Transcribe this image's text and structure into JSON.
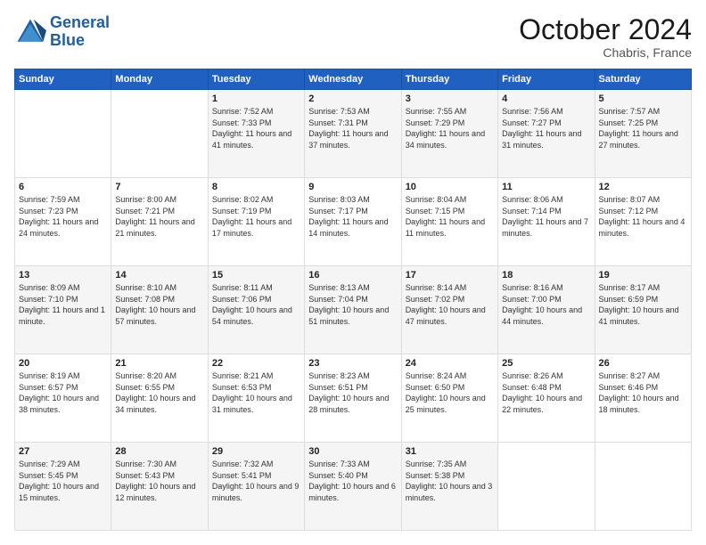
{
  "header": {
    "logo_line1": "General",
    "logo_line2": "Blue",
    "month": "October 2024",
    "location": "Chabris, France"
  },
  "weekdays": [
    "Sunday",
    "Monday",
    "Tuesday",
    "Wednesday",
    "Thursday",
    "Friday",
    "Saturday"
  ],
  "weeks": [
    [
      {
        "day": "",
        "sunrise": "",
        "sunset": "",
        "daylight": ""
      },
      {
        "day": "",
        "sunrise": "",
        "sunset": "",
        "daylight": ""
      },
      {
        "day": "1",
        "sunrise": "Sunrise: 7:52 AM",
        "sunset": "Sunset: 7:33 PM",
        "daylight": "Daylight: 11 hours and 41 minutes."
      },
      {
        "day": "2",
        "sunrise": "Sunrise: 7:53 AM",
        "sunset": "Sunset: 7:31 PM",
        "daylight": "Daylight: 11 hours and 37 minutes."
      },
      {
        "day": "3",
        "sunrise": "Sunrise: 7:55 AM",
        "sunset": "Sunset: 7:29 PM",
        "daylight": "Daylight: 11 hours and 34 minutes."
      },
      {
        "day": "4",
        "sunrise": "Sunrise: 7:56 AM",
        "sunset": "Sunset: 7:27 PM",
        "daylight": "Daylight: 11 hours and 31 minutes."
      },
      {
        "day": "5",
        "sunrise": "Sunrise: 7:57 AM",
        "sunset": "Sunset: 7:25 PM",
        "daylight": "Daylight: 11 hours and 27 minutes."
      }
    ],
    [
      {
        "day": "6",
        "sunrise": "Sunrise: 7:59 AM",
        "sunset": "Sunset: 7:23 PM",
        "daylight": "Daylight: 11 hours and 24 minutes."
      },
      {
        "day": "7",
        "sunrise": "Sunrise: 8:00 AM",
        "sunset": "Sunset: 7:21 PM",
        "daylight": "Daylight: 11 hours and 21 minutes."
      },
      {
        "day": "8",
        "sunrise": "Sunrise: 8:02 AM",
        "sunset": "Sunset: 7:19 PM",
        "daylight": "Daylight: 11 hours and 17 minutes."
      },
      {
        "day": "9",
        "sunrise": "Sunrise: 8:03 AM",
        "sunset": "Sunset: 7:17 PM",
        "daylight": "Daylight: 11 hours and 14 minutes."
      },
      {
        "day": "10",
        "sunrise": "Sunrise: 8:04 AM",
        "sunset": "Sunset: 7:15 PM",
        "daylight": "Daylight: 11 hours and 11 minutes."
      },
      {
        "day": "11",
        "sunrise": "Sunrise: 8:06 AM",
        "sunset": "Sunset: 7:14 PM",
        "daylight": "Daylight: 11 hours and 7 minutes."
      },
      {
        "day": "12",
        "sunrise": "Sunrise: 8:07 AM",
        "sunset": "Sunset: 7:12 PM",
        "daylight": "Daylight: 11 hours and 4 minutes."
      }
    ],
    [
      {
        "day": "13",
        "sunrise": "Sunrise: 8:09 AM",
        "sunset": "Sunset: 7:10 PM",
        "daylight": "Daylight: 11 hours and 1 minute."
      },
      {
        "day": "14",
        "sunrise": "Sunrise: 8:10 AM",
        "sunset": "Sunset: 7:08 PM",
        "daylight": "Daylight: 10 hours and 57 minutes."
      },
      {
        "day": "15",
        "sunrise": "Sunrise: 8:11 AM",
        "sunset": "Sunset: 7:06 PM",
        "daylight": "Daylight: 10 hours and 54 minutes."
      },
      {
        "day": "16",
        "sunrise": "Sunrise: 8:13 AM",
        "sunset": "Sunset: 7:04 PM",
        "daylight": "Daylight: 10 hours and 51 minutes."
      },
      {
        "day": "17",
        "sunrise": "Sunrise: 8:14 AM",
        "sunset": "Sunset: 7:02 PM",
        "daylight": "Daylight: 10 hours and 47 minutes."
      },
      {
        "day": "18",
        "sunrise": "Sunrise: 8:16 AM",
        "sunset": "Sunset: 7:00 PM",
        "daylight": "Daylight: 10 hours and 44 minutes."
      },
      {
        "day": "19",
        "sunrise": "Sunrise: 8:17 AM",
        "sunset": "Sunset: 6:59 PM",
        "daylight": "Daylight: 10 hours and 41 minutes."
      }
    ],
    [
      {
        "day": "20",
        "sunrise": "Sunrise: 8:19 AM",
        "sunset": "Sunset: 6:57 PM",
        "daylight": "Daylight: 10 hours and 38 minutes."
      },
      {
        "day": "21",
        "sunrise": "Sunrise: 8:20 AM",
        "sunset": "Sunset: 6:55 PM",
        "daylight": "Daylight: 10 hours and 34 minutes."
      },
      {
        "day": "22",
        "sunrise": "Sunrise: 8:21 AM",
        "sunset": "Sunset: 6:53 PM",
        "daylight": "Daylight: 10 hours and 31 minutes."
      },
      {
        "day": "23",
        "sunrise": "Sunrise: 8:23 AM",
        "sunset": "Sunset: 6:51 PM",
        "daylight": "Daylight: 10 hours and 28 minutes."
      },
      {
        "day": "24",
        "sunrise": "Sunrise: 8:24 AM",
        "sunset": "Sunset: 6:50 PM",
        "daylight": "Daylight: 10 hours and 25 minutes."
      },
      {
        "day": "25",
        "sunrise": "Sunrise: 8:26 AM",
        "sunset": "Sunset: 6:48 PM",
        "daylight": "Daylight: 10 hours and 22 minutes."
      },
      {
        "day": "26",
        "sunrise": "Sunrise: 8:27 AM",
        "sunset": "Sunset: 6:46 PM",
        "daylight": "Daylight: 10 hours and 18 minutes."
      }
    ],
    [
      {
        "day": "27",
        "sunrise": "Sunrise: 7:29 AM",
        "sunset": "Sunset: 5:45 PM",
        "daylight": "Daylight: 10 hours and 15 minutes."
      },
      {
        "day": "28",
        "sunrise": "Sunrise: 7:30 AM",
        "sunset": "Sunset: 5:43 PM",
        "daylight": "Daylight: 10 hours and 12 minutes."
      },
      {
        "day": "29",
        "sunrise": "Sunrise: 7:32 AM",
        "sunset": "Sunset: 5:41 PM",
        "daylight": "Daylight: 10 hours and 9 minutes."
      },
      {
        "day": "30",
        "sunrise": "Sunrise: 7:33 AM",
        "sunset": "Sunset: 5:40 PM",
        "daylight": "Daylight: 10 hours and 6 minutes."
      },
      {
        "day": "31",
        "sunrise": "Sunrise: 7:35 AM",
        "sunset": "Sunset: 5:38 PM",
        "daylight": "Daylight: 10 hours and 3 minutes."
      },
      {
        "day": "",
        "sunrise": "",
        "sunset": "",
        "daylight": ""
      },
      {
        "day": "",
        "sunrise": "",
        "sunset": "",
        "daylight": ""
      }
    ]
  ]
}
